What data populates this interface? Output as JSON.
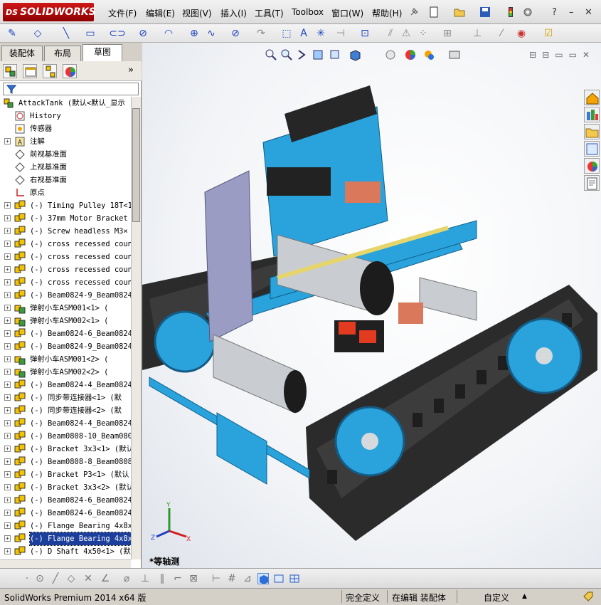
{
  "app": {
    "brand": "SOLIDWORKS",
    "brand_prefix": "DS"
  },
  "menu": [
    "文件(F)",
    "编辑(E)",
    "视图(V)",
    "插入(I)",
    "工具(T)",
    "Toolbox",
    "窗口(W)",
    "帮助(H)"
  ],
  "panel_tabs": [
    "装配体",
    "布局",
    "草图"
  ],
  "active_tab": "草图",
  "tree": [
    {
      "label": "AttackTank  (默认<默认_显示",
      "icon": "assembly-root-icon",
      "expand": false
    },
    {
      "label": "History",
      "icon": "history-icon",
      "expand": false
    },
    {
      "label": "传感器",
      "icon": "sensor-icon",
      "expand": false
    },
    {
      "label": "注解",
      "icon": "annotation-icon",
      "expand": true
    },
    {
      "label": "前视基准面",
      "icon": "plane-icon",
      "expand": false
    },
    {
      "label": "上视基准面",
      "icon": "plane-icon",
      "expand": false
    },
    {
      "label": "右视基准面",
      "icon": "plane-icon",
      "expand": false
    },
    {
      "label": "原点",
      "icon": "origin-icon",
      "expand": false
    },
    {
      "label": "(-) Timing Pulley 18T<1",
      "icon": "part-icon",
      "expand": true
    },
    {
      "label": "(-) 37mm Motor Bracket",
      "icon": "part-icon",
      "expand": true
    },
    {
      "label": "(-) Screw headless M3×",
      "icon": "part-icon",
      "expand": true
    },
    {
      "label": "(-) cross recessed coun",
      "icon": "part-icon",
      "expand": true
    },
    {
      "label": "(-) cross recessed coun",
      "icon": "part-icon",
      "expand": true
    },
    {
      "label": "(-) cross recessed coun",
      "icon": "part-icon",
      "expand": true
    },
    {
      "label": "(-) cross recessed coun",
      "icon": "part-icon",
      "expand": true
    },
    {
      "label": "(-) Beam0824-9_Beam0824",
      "icon": "part-icon",
      "expand": true
    },
    {
      "label": "弹射小车ASM001<1> (",
      "icon": "subassembly-icon",
      "expand": true
    },
    {
      "label": "弹射小车ASM002<1> (",
      "icon": "subassembly-icon",
      "expand": true
    },
    {
      "label": "(-) Beam0824-6_Beam0824",
      "icon": "part-icon",
      "expand": true
    },
    {
      "label": "(-) Beam0824-9_Beam0824",
      "icon": "part-icon",
      "expand": true
    },
    {
      "label": "弹射小车ASM001<2> (",
      "icon": "subassembly-icon",
      "expand": true
    },
    {
      "label": "弹射小车ASM002<2> (",
      "icon": "subassembly-icon",
      "expand": true
    },
    {
      "label": "(-) Beam0824-4_Beam0824",
      "icon": "part-icon",
      "expand": true
    },
    {
      "label": "(-) 同步带连接器<1> (默",
      "icon": "part-icon",
      "expand": true
    },
    {
      "label": "(-) 同步带连接器<2> (默",
      "icon": "part-icon",
      "expand": true
    },
    {
      "label": "(-) Beam0824-4_Beam0824",
      "icon": "part-icon",
      "expand": true
    },
    {
      "label": "(-) Beam0808-10_Beam080",
      "icon": "part-icon",
      "expand": true
    },
    {
      "label": "(-) Bracket 3x3<1> (默认",
      "icon": "part-icon",
      "expand": true
    },
    {
      "label": "(-) Beam0808-8_Beam0808",
      "icon": "part-icon",
      "expand": true
    },
    {
      "label": "(-) Bracket P3<1> (默认",
      "icon": "part-icon",
      "expand": true
    },
    {
      "label": "(-) Bracket 3x3<2> (默认",
      "icon": "part-icon",
      "expand": true
    },
    {
      "label": "(-) Beam0824-6_Beam0824",
      "icon": "part-icon",
      "expand": true
    },
    {
      "label": "(-) Beam0824-6_Beam0824",
      "icon": "part-icon",
      "expand": true
    },
    {
      "label": "(-) Flange Bearing 4x8x",
      "icon": "part-icon",
      "expand": true
    },
    {
      "label": "(-) Flange Bearing 4x8x",
      "icon": "part-icon",
      "expand": true,
      "selected": true
    },
    {
      "label": "(-) D Shaft 4x50<1> (默",
      "icon": "part-icon",
      "expand": true
    }
  ],
  "viewport": {
    "view_label": "*等轴测",
    "triad_axes": [
      "Y",
      "Z",
      "X"
    ]
  },
  "status": {
    "version": "SolidWorks Premium 2014 x64 版",
    "defined": "完全定义",
    "editing": "在编辑 装配体",
    "units": "自定义"
  },
  "colors": {
    "tank_blue": "#2aa2dc",
    "track_black": "#2b2b2b",
    "motor_silver": "#c9cdd1",
    "selection": "#1c3f9b"
  }
}
